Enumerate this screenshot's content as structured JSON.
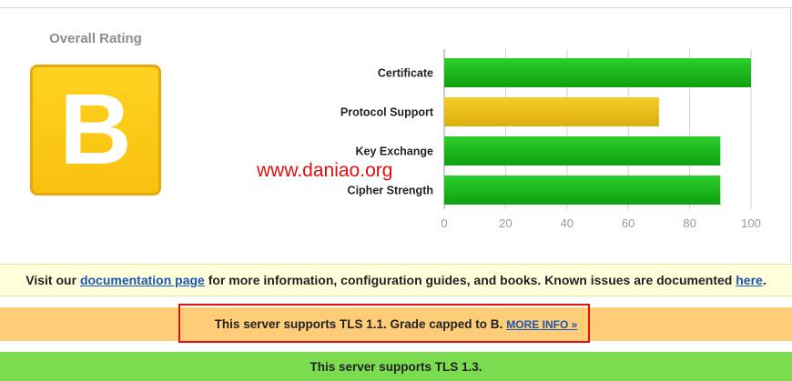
{
  "overall": {
    "label": "Overall Rating",
    "grade": "B"
  },
  "chart_data": {
    "type": "bar",
    "orientation": "horizontal",
    "categories": [
      "Certificate",
      "Protocol Support",
      "Key Exchange",
      "Cipher Strength"
    ],
    "values": [
      100,
      70,
      90,
      90
    ],
    "colors": [
      "#1fb31f",
      "#e6b814",
      "#1fb31f",
      "#1fb31f"
    ],
    "xlim": [
      0,
      100
    ],
    "xticks": [
      "0",
      "20",
      "40",
      "60",
      "80",
      "100"
    ],
    "grid": true
  },
  "watermark": "www.daniao.org",
  "docs_banner": {
    "prefix": "Visit our ",
    "link1": "documentation page",
    "middle": " for more information, configuration guides, and books. Known issues are documented ",
    "link2": "here",
    "suffix": "."
  },
  "tls11_banner": {
    "text": "This server supports TLS 1.1. Grade capped to B.",
    "link": "MORE INFO »"
  },
  "tls13_banner": {
    "text": "This server supports TLS 1.3."
  }
}
